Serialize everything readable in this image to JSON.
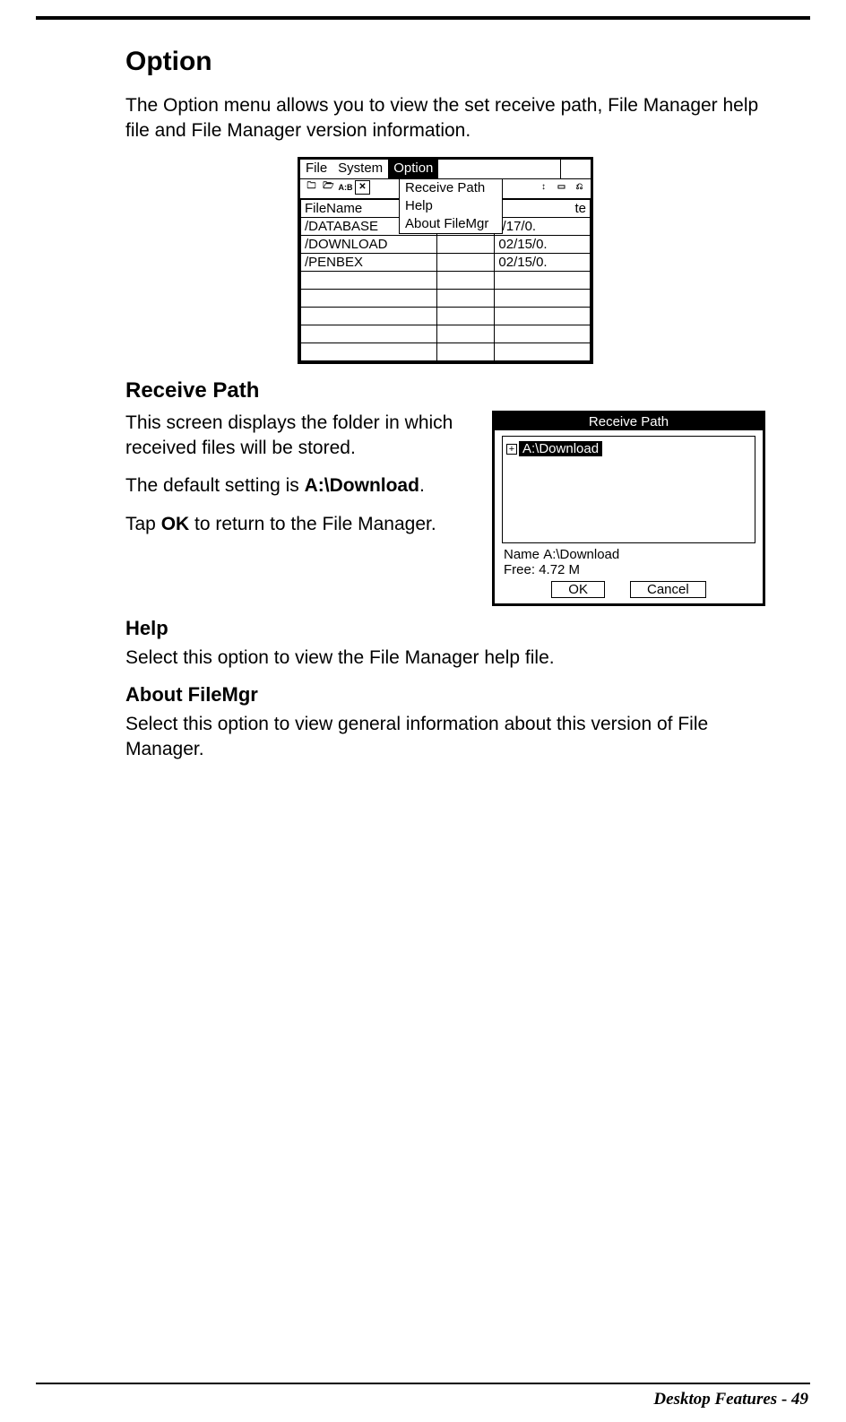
{
  "headings": {
    "option": "Option",
    "receive_path": "Receive Path",
    "help": "Help",
    "about": "About FileMgr"
  },
  "paragraphs": {
    "option_intro": "The Option menu allows you to view the set receive path, File Manager help file and File Manager version information.",
    "receive_path_1": "This screen displays the folder in which received files will be stored.",
    "receive_path_2a": "The default setting is ",
    "receive_path_2b": "A:\\Download",
    "receive_path_2c": ".",
    "receive_path_3a": "Tap ",
    "receive_path_3b": "OK",
    "receive_path_3c": " to return to the File Manager.",
    "help_body": "Select this option to view the File Manager help file.",
    "about_body": "Select this option to view general information about this version of File Manager."
  },
  "shot1": {
    "menu": {
      "file": "File",
      "system": "System",
      "option": "Option"
    },
    "dropdown": {
      "receive_path": "Receive Path",
      "help": "Help",
      "about": "About FileMgr"
    },
    "toolbar_ab": "A:B",
    "headers": {
      "filename": "FileName",
      "date_frag": "te"
    },
    "rows": [
      {
        "name": "/DATABASE",
        "size": "",
        "date": "./17/0."
      },
      {
        "name": "/DOWNLOAD",
        "size": "",
        "date": "02/15/0."
      },
      {
        "name": "/PENBEX",
        "size": "",
        "date": "02/15/0."
      },
      {
        "name": "",
        "size": "",
        "date": ""
      },
      {
        "name": "",
        "size": "",
        "date": ""
      },
      {
        "name": "",
        "size": "",
        "date": ""
      },
      {
        "name": "",
        "size": "",
        "date": ""
      },
      {
        "name": "",
        "size": "",
        "date": ""
      }
    ]
  },
  "shot2": {
    "title": "Receive Path",
    "node": "A:\\Download",
    "name_label": "Name",
    "name_value": "A:\\Download",
    "free_label": "Free:",
    "free_value": "4.72 M",
    "ok": "OK",
    "cancel": "Cancel"
  },
  "footer": {
    "section": "Desktop Features",
    "page": "49"
  }
}
